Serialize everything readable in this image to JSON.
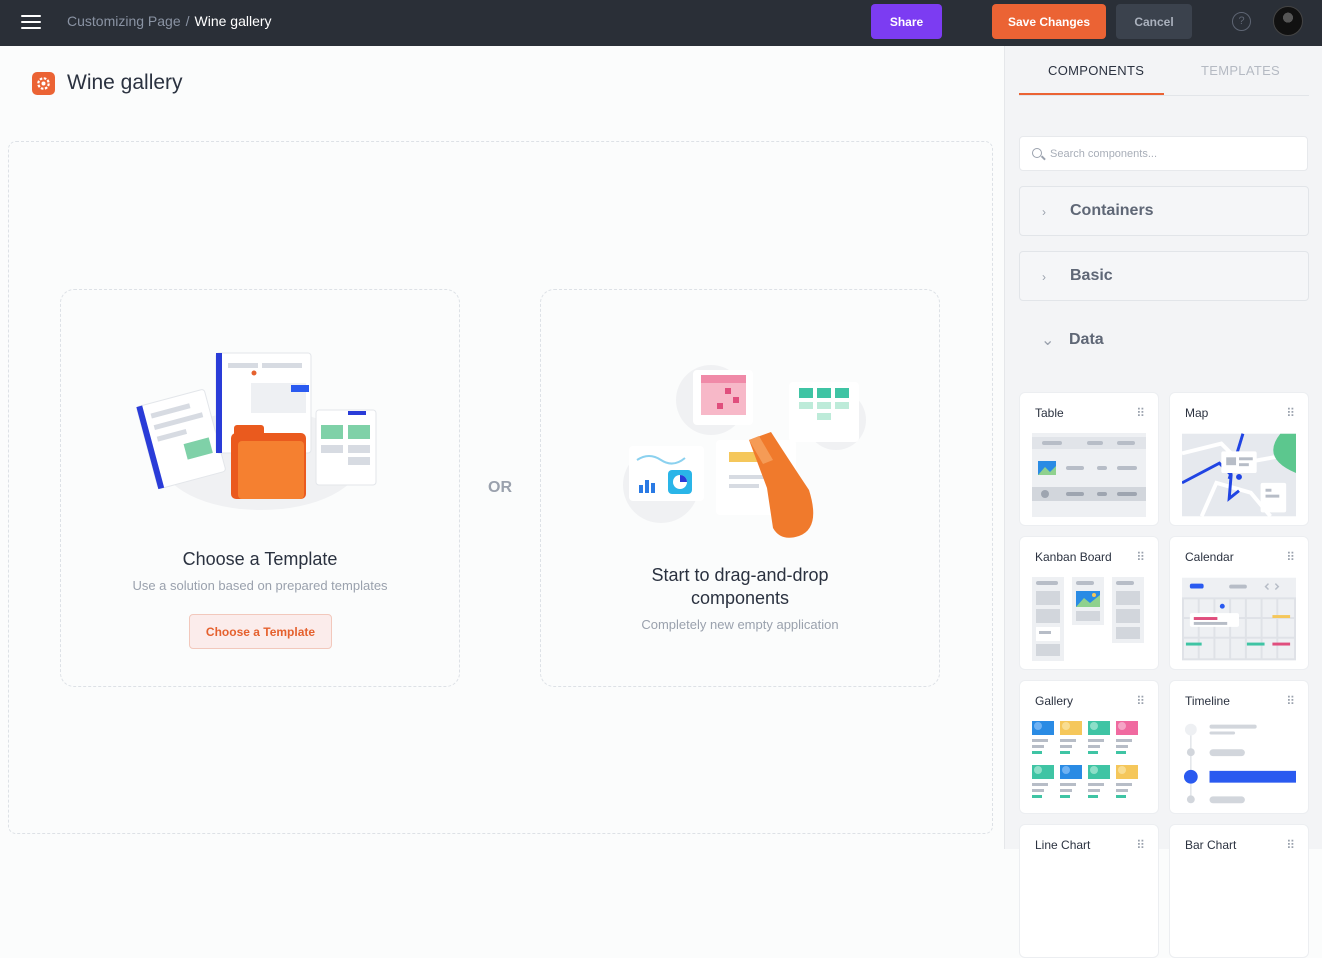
{
  "header": {
    "breadcrumb_parent": "Customizing Page",
    "breadcrumb_separator": "/",
    "breadcrumb_current": "Wine gallery",
    "share_label": "Share",
    "save_label": "Save Changes",
    "cancel_label": "Cancel",
    "help_glyph": "?"
  },
  "page": {
    "title": "Wine gallery"
  },
  "canvas": {
    "or_label": "OR",
    "template_card": {
      "title": "Choose a Template",
      "subtitle": "Use a solution based on prepared templates",
      "button": "Choose a Template"
    },
    "blank_card": {
      "title_line1": "Start to drag-and-drop",
      "title_line2": "components",
      "subtitle": "Completely new empty application"
    }
  },
  "panel": {
    "tabs": [
      "COMPONENTS",
      "TEMPLATES"
    ],
    "active_tab": "COMPONENTS",
    "search_placeholder": "Search components...",
    "groups": [
      {
        "label": "Containers",
        "expanded": false
      },
      {
        "label": "Basic",
        "expanded": false
      },
      {
        "label": "Data",
        "expanded": true
      }
    ],
    "chevron_closed": "›",
    "chevron_open": "⌄",
    "drag_glyph": "⠿",
    "components": [
      "Table",
      "Map",
      "Kanban Board",
      "Calendar",
      "Gallery",
      "Timeline",
      "Line Chart",
      "Bar Chart"
    ]
  },
  "colors": {
    "topbar": "#2a2f37",
    "share": "#7c3cf2",
    "save": "#eb6334",
    "accent": "#eb6334",
    "map_route": "#2044e3",
    "timeline_active": "#2a5af0"
  },
  "icons": [
    "menu-icon",
    "help-icon",
    "gear-icon",
    "search-icon",
    "chevron-right-icon",
    "chevron-down-icon",
    "drag-handle-icon"
  ]
}
